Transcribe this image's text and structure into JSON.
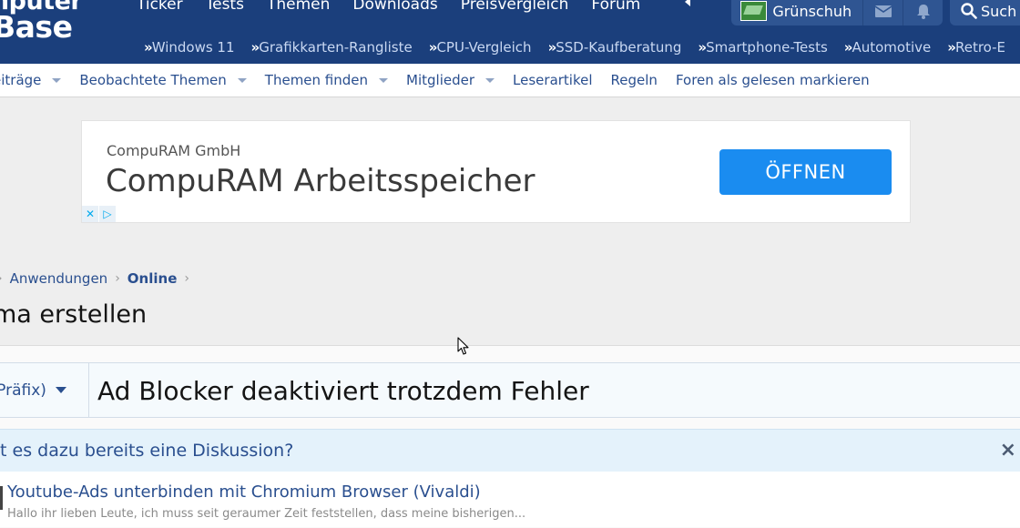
{
  "header": {
    "logo_top": "mputer",
    "logo_bottom": "Base",
    "nav": [
      "Ticker",
      "Tests",
      "Themen",
      "Downloads",
      "Preisvergleich",
      "Forum"
    ],
    "username": "Grünschuh",
    "search_label": "Such",
    "subnav": [
      "Windows 11",
      "Grafikkarten-Rangliste",
      "CPU-Vergleich",
      "SSD-Kaufberatung",
      "Smartphone-Tests",
      "Automotive",
      "Retro-E"
    ]
  },
  "secnav": {
    "items": [
      {
        "label": "eiträge",
        "has_caret": true
      },
      {
        "label": "Beobachtete Themen",
        "has_caret": true
      },
      {
        "label": "Themen finden",
        "has_caret": true
      },
      {
        "label": "Mitglieder",
        "has_caret": true
      },
      {
        "label": "Leserartikel",
        "has_caret": false
      },
      {
        "label": "Regeln",
        "has_caret": false
      },
      {
        "label": "Foren als gelesen markieren",
        "has_caret": false
      }
    ]
  },
  "ad": {
    "company": "CompuRAM GmbH",
    "headline": "CompuRAM Arbeitsspeicher",
    "button": "ÖFFNEN"
  },
  "breadcrumb": {
    "link": "Anwendungen",
    "current": "Online"
  },
  "page_title": "ma erstellen",
  "form": {
    "prefix": "n Präfix)",
    "title_value": "Ad Blocker deaktiviert trotzdem Fehler"
  },
  "similar": {
    "question": "bt es dazu bereits eine Diskussion?",
    "close": "×",
    "result_title": "Youtube-Ads unterbinden mit Chromium Browser (Vivaldi)",
    "result_snippet": "Hallo ihr lieben Leute, ich muss seit geraumer Zeit feststellen, dass meine bisherigen..."
  },
  "colors": {
    "header_bg": "#1b3f7c",
    "link": "#2a4f8f",
    "ad_button": "#1a8cf0"
  }
}
